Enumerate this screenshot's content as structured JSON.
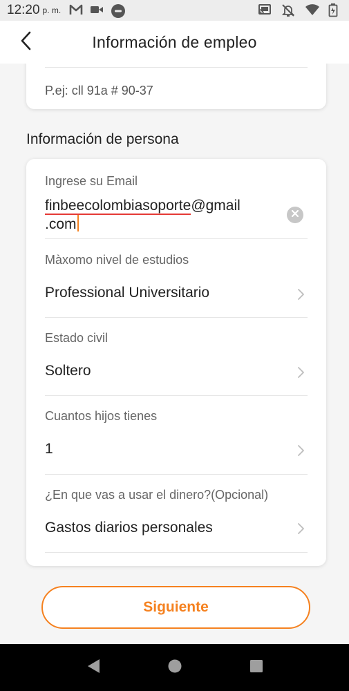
{
  "status_bar": {
    "time": "12:20",
    "ampm": "p. m."
  },
  "header": {
    "title": "Información de empleo"
  },
  "address_card": {
    "hint": "P.ej: cll 91a # 90-37"
  },
  "person_section": {
    "title": "Información de persona",
    "email": {
      "label": "Ingrese su Email",
      "value_part1": "finbeecolombiasoporte",
      "value_part2": "@gmail",
      "value_part3": ".com"
    },
    "education": {
      "label": "Màxomo nivel de estudios",
      "value": "Professional Universitario"
    },
    "civil_status": {
      "label": "Estado civil",
      "value": "Soltero"
    },
    "children": {
      "label": "Cuantos hijos tienes",
      "value": "1"
    },
    "money_use": {
      "label": "¿En que vas a usar el dinero?(Opcional)",
      "value": "Gastos diarios personales"
    }
  },
  "next_button": {
    "label": "Siguiente"
  },
  "colors": {
    "accent": "#f5811f",
    "spell_underline": "#e53935"
  },
  "icons": {
    "status_left": [
      "gmail-icon",
      "video-icon",
      "record-icon"
    ],
    "status_right": [
      "cast-icon",
      "bell-off-icon",
      "wifi-icon",
      "battery-icon"
    ],
    "nav": [
      "back-icon",
      "home-icon",
      "recents-icon"
    ]
  }
}
